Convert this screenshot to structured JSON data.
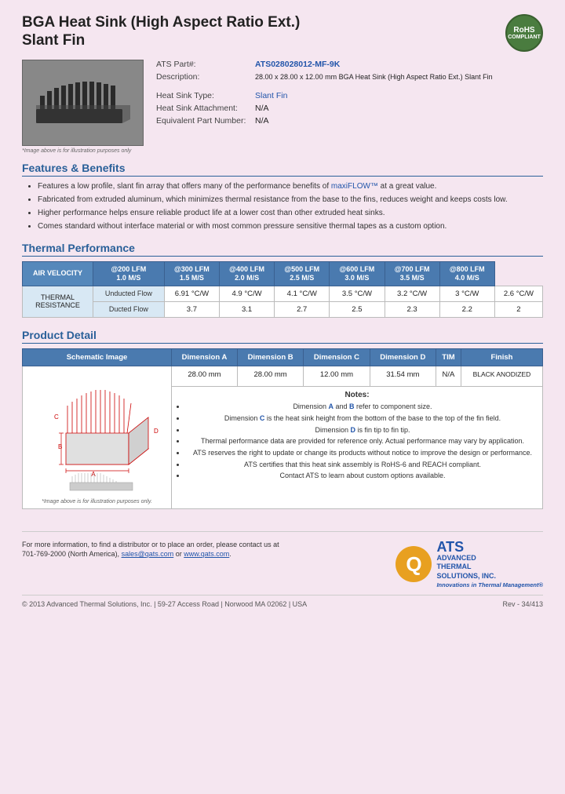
{
  "header": {
    "title_line1": "BGA Heat Sink (High Aspect Ratio Ext.)",
    "title_line2": "Slant Fin",
    "rohs": "RoHS\nCOMPLIANT"
  },
  "product": {
    "part_label": "ATS Part#:",
    "part_number": "ATS028028012-MF-9K",
    "desc_label": "Description:",
    "description": "28.00 x 28.00 x 12.00 mm BGA Heat Sink (High Aspect Ratio Ext.) Slant Fin",
    "type_label": "Heat Sink Type:",
    "type_value": "Slant Fin",
    "attachment_label": "Heat Sink Attachment:",
    "attachment_value": "N/A",
    "equiv_label": "Equivalent Part Number:",
    "equiv_value": "N/A",
    "image_caption": "*Image above is for illustration purposes only"
  },
  "features": {
    "title": "Features & Benefits",
    "items": [
      "Features a low profile, slant fin array that offers many of the performance benefits of maxiFLOW™ at a great value.",
      "Fabricated from extruded aluminum, which minimizes thermal resistance from the base to the fins, reduces weight and keeps costs low.",
      "Higher performance helps ensure reliable product life at a lower cost than other extruded heat sinks.",
      "Comes standard without interface material or with most common pressure sensitive thermal tapes as a custom option."
    ]
  },
  "thermal": {
    "title": "Thermal Performance",
    "col_headers": [
      "AIR VELOCITY",
      "@200 LFM\n1.0 M/S",
      "@300 LFM\n1.5 M/S",
      "@400 LFM\n2.0 M/S",
      "@500 LFM\n2.5 M/S",
      "@600 LFM\n3.0 M/S",
      "@700 LFM\n3.5 M/S",
      "@800 LFM\n4.0 M/S"
    ],
    "row_label": "THERMAL RESISTANCE",
    "rows": [
      {
        "label": "Unducted Flow",
        "values": [
          "6.91 °C/W",
          "4.9 °C/W",
          "4.1 °C/W",
          "3.5 °C/W",
          "3.2 °C/W",
          "3 °C/W",
          "2.6 °C/W"
        ]
      },
      {
        "label": "Ducted Flow",
        "values": [
          "3.7",
          "3.1",
          "2.7",
          "2.5",
          "2.3",
          "2.2",
          "2"
        ]
      }
    ]
  },
  "product_detail": {
    "title": "Product Detail",
    "col_headers": [
      "Schematic Image",
      "Dimension A",
      "Dimension B",
      "Dimension C",
      "Dimension D",
      "TIM",
      "Finish"
    ],
    "dim_values": [
      "28.00 mm",
      "28.00 mm",
      "12.00 mm",
      "31.54 mm",
      "N/A",
      "BLACK ANODIZED"
    ],
    "schematic_caption": "*Image above is for illustration purposes only.",
    "notes_title": "Notes:",
    "notes": [
      "Dimension A and B refer to component size.",
      "Dimension C is the heat sink height from the bottom of the base to the top of the fin field.",
      "Dimension D is fin tip to fin tip.",
      "Thermal performance data are provided for reference only. Actual performance may vary by application.",
      "ATS reserves the right to update or change its products without notice to improve the design or performance.",
      "ATS certifies that this heat sink assembly is RoHS-6 and REACH compliant.",
      "Contact ATS to learn about custom options available."
    ]
  },
  "footer": {
    "contact_text": "For more information, to find a distributor or to place an order, please contact us at\n701-769-2000 (North America),",
    "email": "sales@qats.com",
    "or_text": " or ",
    "website": "www.qats.com",
    "copyright": "© 2013 Advanced Thermal Solutions, Inc.  |  59-27 Access Road  |  Norwood MA  02062  |  USA",
    "page_num": "Rev - 34/413",
    "ats_name": "ADVANCED\nTHERMAL\nSOLUTIONS, INC.",
    "ats_tagline": "Innovations in Thermal Management®"
  }
}
